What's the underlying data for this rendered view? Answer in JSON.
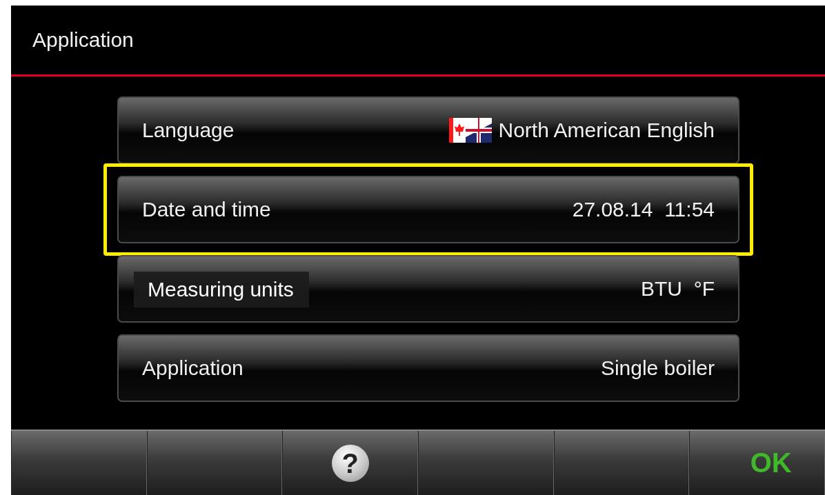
{
  "header": {
    "title": "Application"
  },
  "rows": [
    {
      "label": "Language",
      "value": "North American English",
      "flag": true,
      "highlighted": false
    },
    {
      "label": "Date and time",
      "value": "27.08.14  11:54",
      "highlighted": true
    },
    {
      "value": "BTU  °F",
      "highlighted": false,
      "tooltip": "Measuring units"
    },
    {
      "label": "Application",
      "value": "Single boiler",
      "highlighted": false
    }
  ],
  "bottom_bar": [
    {
      "kind": "blank"
    },
    {
      "kind": "blank"
    },
    {
      "kind": "help",
      "label": "?"
    },
    {
      "kind": "blank"
    },
    {
      "kind": "blank"
    },
    {
      "kind": "ok",
      "label": "OK"
    }
  ]
}
